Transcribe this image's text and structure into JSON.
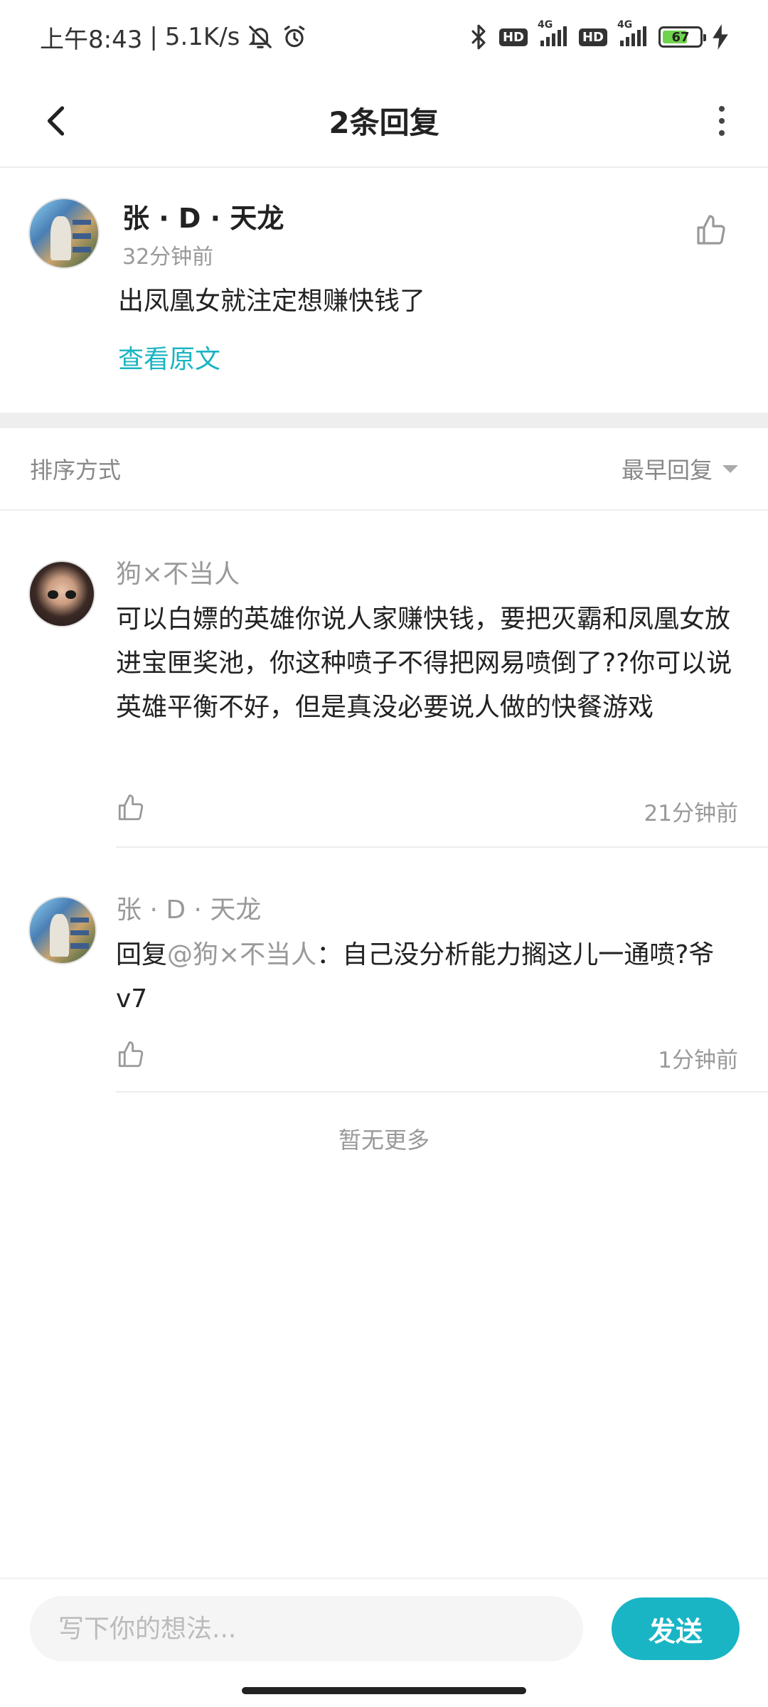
{
  "status_bar": {
    "time": "上午8:43",
    "separator": "|",
    "network_speed": "5.1K/s",
    "battery_level": "67",
    "battery_fraction": 0.67,
    "hd_badge_1": "HD",
    "hd_badge_2": "HD",
    "signal_label_1": "4G",
    "signal_label_2": "4G",
    "icons": [
      "bell-off-icon",
      "alarm-icon",
      "bluetooth-icon",
      "signal-icon",
      "charging-icon"
    ]
  },
  "header": {
    "title": "2条回复"
  },
  "original": {
    "author": "张 · D · 天龙",
    "time": "32分钟前",
    "body": "出凤凰女就注定想赚快钱了",
    "view_original": "查看原文"
  },
  "sort": {
    "label": "排序方式",
    "selected": "最早回复"
  },
  "replies": [
    {
      "author": "狗×不当人",
      "body": "可以白嫖的英雄你说人家赚快钱，要把灭霸和凤凰女放进宝匣奖池，你这种喷子不得把网易喷倒了??你可以说英雄平衡不好，但是真没必要说人做的快餐游戏",
      "time": "21分钟前"
    },
    {
      "author": "张 · D · 天龙",
      "reply_prefix": "回复",
      "mention": "@狗×不当人",
      "body": "：自己没分析能力搁这儿一通喷?爷v7",
      "time": "1分钟前"
    }
  ],
  "end_text": "暂无更多",
  "composer": {
    "placeholder": "写下你的想法...",
    "send_label": "发送"
  },
  "colors": {
    "accent": "#19b5c5",
    "link": "#1ab4c2",
    "muted_text": "#999999"
  }
}
